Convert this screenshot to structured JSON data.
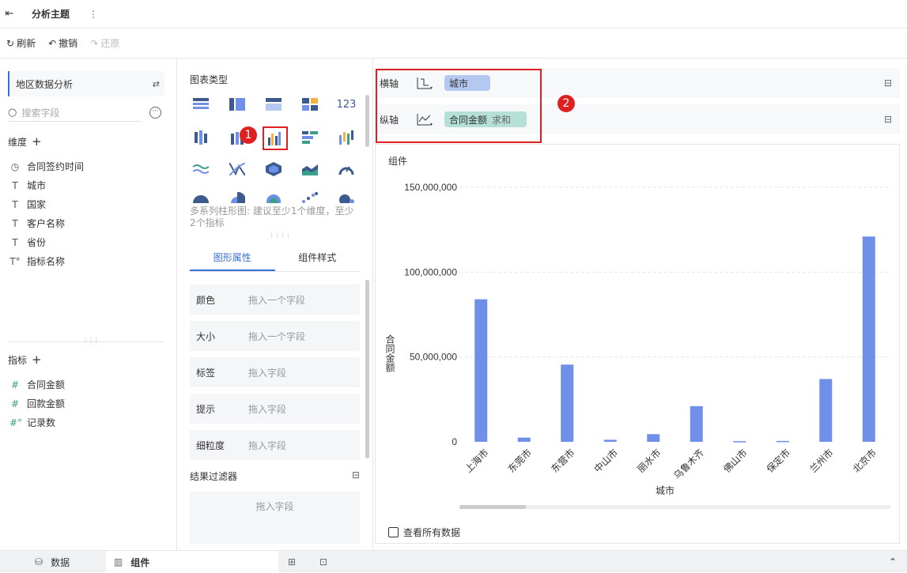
{
  "topbar": {
    "back_icon": "exit-icon",
    "title": "分析主题",
    "more_icon": "more-vertical-icon"
  },
  "toolbar": {
    "refresh": "刷新",
    "undo": "撤销",
    "redo": "还原"
  },
  "left": {
    "package_name": "地区数据分析",
    "search_placeholder": "搜索字段",
    "dimension_title": "维度",
    "dimensions": [
      {
        "icon": "clock-icon",
        "label": "合同签约时间"
      },
      {
        "icon": "text-icon",
        "label": "城市"
      },
      {
        "icon": "text-icon",
        "label": "国家"
      },
      {
        "icon": "text-icon",
        "label": "客户名称"
      },
      {
        "icon": "text-icon",
        "label": "省份"
      },
      {
        "icon": "text-calc-icon",
        "label": "指标名称"
      }
    ],
    "measure_title": "指标",
    "measures": [
      {
        "icon": "hash-icon",
        "label": "合同金额"
      },
      {
        "icon": "hash-icon",
        "label": "回款金额"
      },
      {
        "icon": "hash-calc-icon",
        "label": "记录数"
      }
    ]
  },
  "middle": {
    "chart_type_title": "图表类型",
    "hint": "多系列柱形图: 建议至少1个维度，至少2个指标",
    "tabs": [
      "图形属性",
      "组件样式"
    ],
    "props": [
      {
        "label": "颜色",
        "value": "拖入一个字段"
      },
      {
        "label": "大小",
        "value": "拖入一个字段"
      },
      {
        "label": "标签",
        "value": "拖入字段"
      },
      {
        "label": "提示",
        "value": "拖入字段"
      },
      {
        "label": "细粒度",
        "value": "拖入字段"
      }
    ],
    "filter_title": "结果过滤器",
    "filter_placeholder": "拖入字段",
    "badge1": "1"
  },
  "axes": {
    "x_label": "横轴",
    "x_field": "城市",
    "y_label": "纵轴",
    "y_field": "合同金额",
    "y_agg": "求和",
    "badge2": "2"
  },
  "chart_title": "组件",
  "show_all_label": "查看所有数据",
  "colors": {
    "accent": "#3a6fd8",
    "bar": "#6f8fe8",
    "red": "#e02020",
    "pill_blue": "#b5c8f0",
    "pill_green": "#b5e0d6"
  },
  "chart_data": {
    "type": "bar",
    "categories": [
      "上海市",
      "东莞市",
      "东营市",
      "中山市",
      "丽水市",
      "乌鲁木齐",
      "佛山市",
      "保定市",
      "兰州市",
      "北京市"
    ],
    "values": [
      84000000,
      2500000,
      45500000,
      1200000,
      4500000,
      21000000,
      400000,
      500000,
      37000000,
      121000000
    ],
    "ylim": [
      0,
      150000000
    ],
    "yticks": [
      "0",
      "50,000,000",
      "100,000,000",
      "150,000,000"
    ],
    "xlabel": "城市",
    "ylabel": "合同金额",
    "grid": true
  },
  "bottom": {
    "data_tab": "数据",
    "component_tab": "组件"
  }
}
